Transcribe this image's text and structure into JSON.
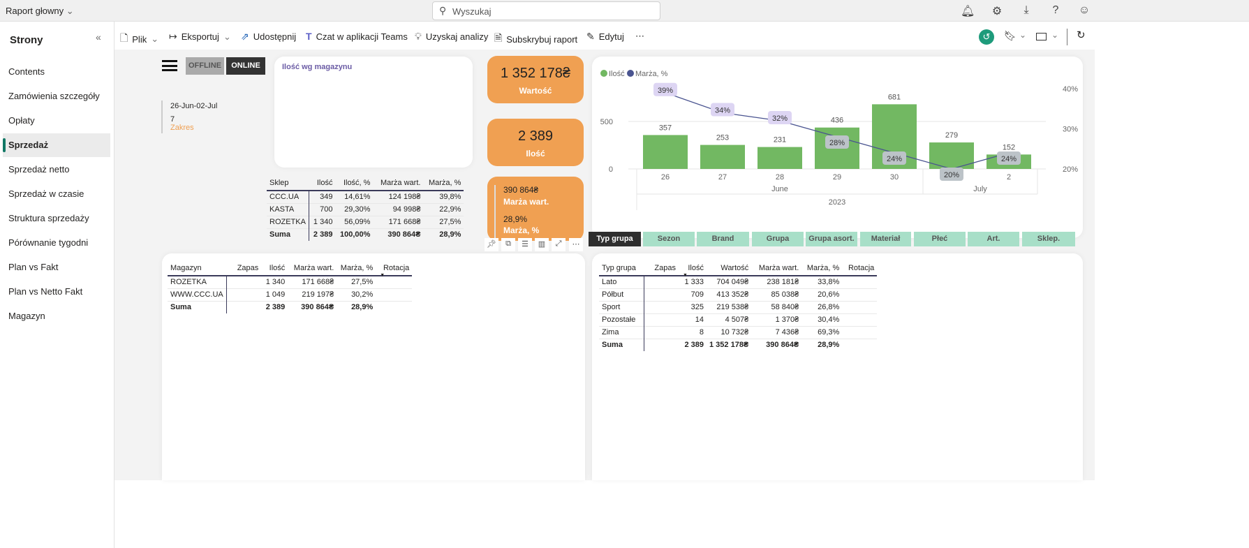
{
  "topbar": {
    "title": "Raport głowny",
    "search_placeholder": "Wyszukaj",
    "icons": [
      "bell-icon",
      "gear-icon",
      "download-icon",
      "help-icon",
      "feedback-icon"
    ]
  },
  "sidebar": {
    "title": "Strony",
    "items": [
      {
        "label": "Contents"
      },
      {
        "label": "Zamówienia szczegóły"
      },
      {
        "label": "Opłaty"
      },
      {
        "label": "Sprzedaż",
        "selected": true
      },
      {
        "label": "Sprzedaż netto"
      },
      {
        "label": "Sprzedaż w czasie"
      },
      {
        "label": "Struktura sprzedaży"
      },
      {
        "label": "Pórównanie tygodni"
      },
      {
        "label": "Plan vs Fakt"
      },
      {
        "label": "Plan vs Netto Fakt"
      },
      {
        "label": "Magazyn"
      }
    ]
  },
  "toolbar": {
    "file": "Plik",
    "export": "Eksportuj",
    "share": "Udostępnij",
    "teams": "Czat w aplikacji Teams",
    "insights": "Uzyskaj analizy",
    "subscribe": "Subskrybuj raport",
    "edit": "Edytuj",
    "more": "⋯"
  },
  "filters": {
    "offline": "OFFLINE",
    "online": "ONLINE",
    "date_range": "26-Jun-02-Jul",
    "days": "7",
    "range_label": "Zakres"
  },
  "warehouse_card": {
    "title": "Ilość wg magazynu"
  },
  "store_table": {
    "headers": [
      "Sklep",
      "Ilość",
      "Ilość, %",
      "Marża wart.",
      "Marża, %"
    ],
    "rows": [
      [
        "CCC.UA",
        "349",
        "14,61%",
        "124 198₴",
        "39,8%"
      ],
      [
        "KASTA",
        "700",
        "29,30%",
        "94 998₴",
        "22,9%"
      ],
      [
        "ROZETKA",
        "1 340",
        "56,09%",
        "171 668₴",
        "27,5%"
      ]
    ],
    "total": [
      "Suma",
      "2 389",
      "100,00%",
      "390 864₴",
      "28,9%"
    ]
  },
  "kpis": {
    "value": "1 352 178₴",
    "value_label": "Wartość",
    "qty": "2 389",
    "qty_label": "Ilość",
    "margin_value": "390 864₴",
    "margin_value_label": "Marża wart.",
    "margin_pct": "28,9%",
    "margin_pct_label": "Marża, %"
  },
  "colors": {
    "kpi": "#f0a052",
    "bar": "#72b862",
    "line": "#4a5490",
    "accent": "#117865",
    "slicer": "#a8dfc8"
  },
  "chart_data": {
    "type": "bar+line",
    "legend": [
      "Ilość",
      "Marża, %"
    ],
    "legend_position": "top-left",
    "categories": [
      "26",
      "27",
      "28",
      "29",
      "30",
      "1",
      "2"
    ],
    "months": [
      {
        "label": "June",
        "span": 5
      },
      {
        "label": "July",
        "span": 2
      }
    ],
    "year": "2023",
    "series": [
      {
        "name": "Ilość",
        "type": "bar",
        "values": [
          357,
          253,
          231,
          436,
          681,
          279,
          152
        ]
      },
      {
        "name": "Marża, %",
        "type": "line",
        "axis": "right",
        "values": [
          39,
          34,
          32,
          28,
          24,
          20,
          24
        ]
      }
    ],
    "y_left": {
      "ticks": [
        "0",
        "500"
      ],
      "range": [
        0,
        500
      ]
    },
    "y_right": {
      "ticks": [
        "20%",
        "30%",
        "40%"
      ],
      "range": [
        20,
        40
      ]
    }
  },
  "slicers": [
    "Typ grupa",
    "Sezon",
    "Brand",
    "Grupa",
    "Grupa asort.",
    "Materiał",
    "Płeć",
    "Art.",
    "Sklep."
  ],
  "mag_table": {
    "headers": [
      "Magazyn",
      "Zapas",
      "Ilość",
      "Marża wart.",
      "Marża, %",
      "Rotacja"
    ],
    "rows": [
      [
        "ROZETKA",
        "",
        "1 340",
        "171 668₴",
        "27,5%",
        ""
      ],
      [
        "WWW.CCC.UA",
        "",
        "1 049",
        "219 197₴",
        "30,2%",
        ""
      ]
    ],
    "total": [
      "Suma",
      "",
      "2 389",
      "390 864₴",
      "28,9%",
      ""
    ]
  },
  "type_table": {
    "headers": [
      "Typ grupa",
      "Zapas",
      "Ilość",
      "Wartość",
      "Marża wart.",
      "Marża, %",
      "Rotacja"
    ],
    "rows": [
      [
        "Lato",
        "",
        "1 333",
        "704 049₴",
        "238 181₴",
        "33,8%",
        ""
      ],
      [
        "Półbut",
        "",
        "709",
        "413 352₴",
        "85 038₴",
        "20,6%",
        ""
      ],
      [
        "Sport",
        "",
        "325",
        "219 538₴",
        "58 840₴",
        "26,8%",
        ""
      ],
      [
        "Pozostałe",
        "",
        "14",
        "4 507₴",
        "1 370₴",
        "30,4%",
        ""
      ],
      [
        "Zima",
        "",
        "8",
        "10 732₴",
        "7 436₴",
        "69,3%",
        ""
      ]
    ],
    "total": [
      "Suma",
      "",
      "2 389",
      "1 352 178₴",
      "390 864₴",
      "28,9%",
      ""
    ]
  }
}
